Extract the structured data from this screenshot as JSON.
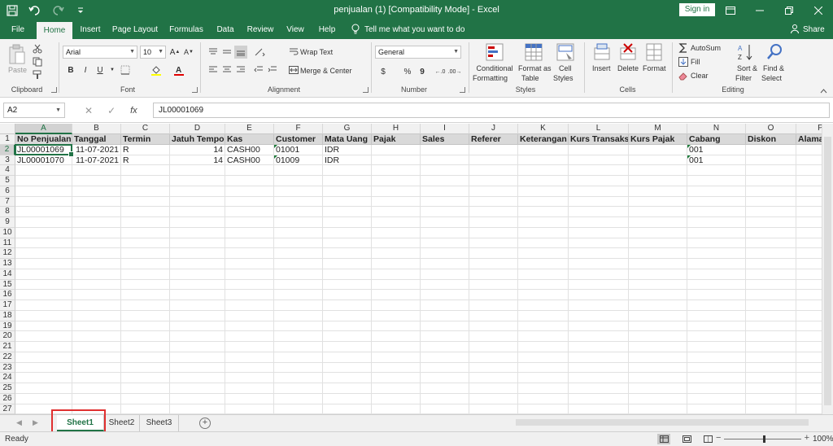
{
  "window": {
    "title": "penjualan (1)  [Compatibility Mode]  -  Excel",
    "signin": "Sign in"
  },
  "tabs": [
    "File",
    "Home",
    "Insert",
    "Page Layout",
    "Formulas",
    "Data",
    "Review",
    "View",
    "Help"
  ],
  "active_tab": "Home",
  "tell_me": "Tell me what you want to do",
  "share": "Share",
  "ribbon": {
    "clipboard": {
      "label": "Clipboard",
      "paste": "Paste"
    },
    "font": {
      "label": "Font",
      "name": "Arial",
      "size": "10",
      "bold": "B",
      "italic": "I",
      "underline": "U"
    },
    "alignment": {
      "label": "Alignment",
      "wrap": "Wrap Text",
      "merge": "Merge & Center"
    },
    "number": {
      "label": "Number",
      "format": "General",
      "currency": "$",
      "percent": "%",
      "comma": "9"
    },
    "styles": {
      "label": "Styles",
      "cond_1": "Conditional",
      "cond_2": "Formatting",
      "table_1": "Format as",
      "table_2": "Table",
      "cell_1": "Cell",
      "cell_2": "Styles"
    },
    "cells": {
      "label": "Cells",
      "insert": "Insert",
      "delete": "Delete",
      "format": "Format"
    },
    "editing": {
      "label": "Editing",
      "autosum": "AutoSum",
      "fill": "Fill",
      "clear": "Clear",
      "sort_1": "Sort &",
      "sort_2": "Filter",
      "find_1": "Find &",
      "find_2": "Select"
    }
  },
  "formula_bar": {
    "name_box": "A2",
    "fx": "fx",
    "value": "JL00001069"
  },
  "columns": [
    "A",
    "B",
    "C",
    "D",
    "E",
    "F",
    "G",
    "H",
    "I",
    "J",
    "K",
    "L",
    "M",
    "N",
    "O",
    "P"
  ],
  "rows": [
    "1",
    "2",
    "3",
    "4",
    "5",
    "6",
    "7",
    "8",
    "9",
    "10",
    "11",
    "12",
    "13",
    "14",
    "15",
    "16",
    "17",
    "18",
    "19",
    "20",
    "21",
    "22",
    "23",
    "24",
    "25",
    "26",
    "27"
  ],
  "headers": [
    "No Penjualan",
    "Tanggal",
    "Termin",
    "Jatuh Tempo",
    "Kas",
    "Customer",
    "Mata Uang",
    "Pajak",
    "Sales",
    "Referer",
    "Keterangan",
    "Kurs Transaksi",
    "Kurs Pajak",
    "Cabang",
    "Diskon",
    "Alamat"
  ],
  "data_rows": [
    [
      "JL00001069",
      "11-07-2021",
      "R",
      "14",
      "CASH00",
      "01001",
      "IDR",
      "",
      "",
      "",
      "",
      "",
      "",
      "001",
      "",
      ""
    ],
    [
      "JL00001070",
      "11-07-2021",
      "R",
      "14",
      "CASH00",
      "01009",
      "IDR",
      "",
      "",
      "",
      "",
      "",
      "",
      "001",
      "",
      ""
    ]
  ],
  "sheets": [
    "Sheet1",
    "Sheet2",
    "Sheet3"
  ],
  "active_sheet": "Sheet1",
  "status": {
    "ready": "Ready",
    "zoom": "100%"
  }
}
